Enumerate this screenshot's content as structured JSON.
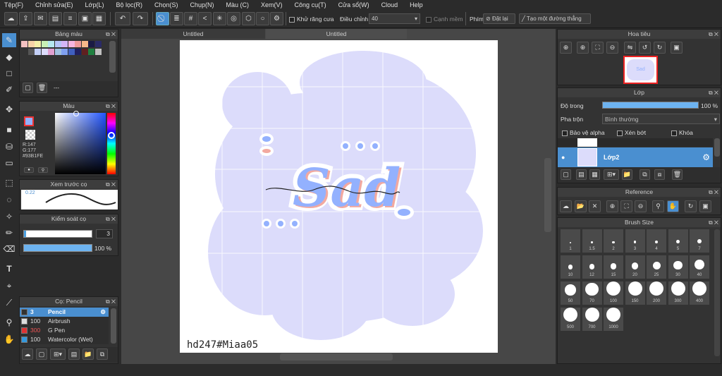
{
  "menu": [
    "Tệp(F)",
    "Chỉnh sửa(E)",
    "Lớp(L)",
    "Bộ lọc(R)",
    "Chọn(S)",
    "Chụp(N)",
    "Màu (C)",
    "Xem(V)",
    "Công cụ(T)",
    "Cửa sổ(W)",
    "Cloud",
    "Help"
  ],
  "toolbar": {
    "antialias_label": "Khử răng cưa",
    "adjust_label": "Điều chỉnh",
    "adjust_value": "40",
    "smooth_edge_label": "Cạnh mềm",
    "key_label": "Phím",
    "reset_label": "Đặt lại",
    "straight_line_label": "Tạo một đường thẳng"
  },
  "canvas": {
    "tabs": [
      "Untitled",
      "Untitled"
    ],
    "watermark": "hd247#Miaa05",
    "art_text": "Sad"
  },
  "palette_panel": {
    "title": "Bảng màu",
    "dash": "---"
  },
  "color_panel": {
    "title": "Màu",
    "r": "R:147",
    "g": "G:177",
    "hex": "#93B1FE",
    "current": "#93B1FE"
  },
  "stroke_preview": {
    "title": "Xem trước cọ",
    "value": "0.22"
  },
  "brush_control": {
    "title": "Kiểm soát cọ",
    "size": "3",
    "opacity": "100 %"
  },
  "brush_list": {
    "title": "Cọ: Pencil",
    "items": [
      {
        "size": "3",
        "name": "Pencil",
        "color": "#333333"
      },
      {
        "size": "100",
        "name": "Airbrush",
        "color": "#dddddd"
      },
      {
        "size": "300",
        "name": "G Pen",
        "color": "#dd3333"
      },
      {
        "size": "100",
        "name": "Watercolor (Wet)",
        "color": "#3399dd"
      }
    ]
  },
  "navigator": {
    "title": "Hoa tiêu",
    "thumb_text": "Sad"
  },
  "layer_panel": {
    "title": "Lớp",
    "opacity_label": "Độ trong",
    "opacity_value": "100 %",
    "blend_label": "Pha trộn",
    "blend_value": "Bình thường",
    "protect_alpha": "Bảo vệ alpha",
    "clipping": "Xén bớt",
    "lock": "Khóa",
    "layer_name": "Lớp2"
  },
  "reference": {
    "title": "Reference"
  },
  "brush_size": {
    "title": "Brush Size",
    "sizes": [
      "1",
      "1.5",
      "2",
      "3",
      "4",
      "5",
      "7",
      "10",
      "12",
      "15",
      "20",
      "25",
      "30",
      "40",
      "50",
      "70",
      "100",
      "150",
      "200",
      "300",
      "400",
      "500",
      "700",
      "1000"
    ]
  }
}
